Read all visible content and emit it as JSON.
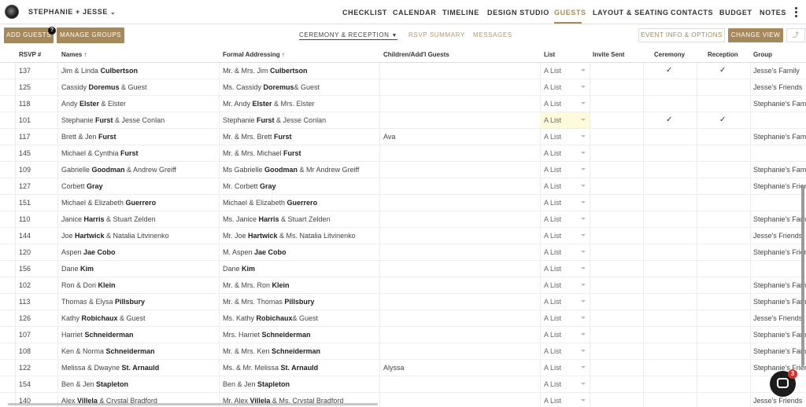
{
  "nav": {
    "couple": "STEPHANIE + JESSE",
    "items": [
      "CHECKLIST",
      "CALENDAR",
      "TIMELINE",
      "DESIGN STUDIO",
      "GUESTS",
      "LAYOUT & SEATING",
      "CONTACTS",
      "BUDGET",
      "NOTES"
    ],
    "active": "GUESTS"
  },
  "toolbar": {
    "add_guests": "ADD GUESTS",
    "help_badge": "?",
    "manage_groups": "MANAGE GROUPS",
    "views": [
      "CEREMONY & RECEPTION",
      "RSVP SUMMARY",
      "MESSAGES"
    ],
    "event_info": "EVENT INFO & OPTIONS",
    "change_view": "CHANGE VIEW"
  },
  "table": {
    "columns": [
      "RSVP #",
      "Names",
      "Formal Addressing",
      "Children/Add'l Guests",
      "List",
      "Invite Sent",
      "Ceremony",
      "Reception",
      "Group"
    ],
    "sort_indicator": "↑",
    "rows": [
      {
        "rsvp": "137",
        "name_pre": "Jim & Linda ",
        "name_bold": "Culbertson",
        "name_post": "",
        "formal_pre": "Mr. & Mrs. Jim ",
        "formal_bold": "Culbertson",
        "formal_post": "",
        "children": "",
        "list": "A List",
        "ceremony": true,
        "reception": true,
        "group": "Jesse's Family"
      },
      {
        "rsvp": "125",
        "name_pre": "Cassidy ",
        "name_bold": "Doremus",
        "name_post": " & Guest",
        "formal_pre": "Ms. Cassidy ",
        "formal_bold": "Doremus",
        "formal_post": "& Guest",
        "children": "",
        "list": "A List",
        "ceremony": false,
        "reception": false,
        "group": "Jesse's Friends"
      },
      {
        "rsvp": "118",
        "name_pre": "Andy ",
        "name_bold": "Elster",
        "name_post": " & Elster",
        "formal_pre": "Mr. Andy ",
        "formal_bold": "Elster",
        "formal_post": " & Mrs. Elster",
        "children": "",
        "list": "A List",
        "ceremony": false,
        "reception": false,
        "group": "Stephanie's Family"
      },
      {
        "rsvp": "101",
        "name_pre": "Stephanie ",
        "name_bold": "Furst",
        "name_post": " & Jesse Conlan",
        "formal_pre": "Stephanie ",
        "formal_bold": "Furst",
        "formal_post": " & Jesse Conlan",
        "children": "",
        "list": "A List",
        "ceremony": true,
        "reception": true,
        "group": "",
        "highlight": true
      },
      {
        "rsvp": "117",
        "name_pre": "Brett & Jen ",
        "name_bold": "Furst",
        "name_post": "",
        "formal_pre": "Mr. & Mrs. Brett ",
        "formal_bold": "Furst",
        "formal_post": "",
        "children": "Ava",
        "list": "A List",
        "ceremony": false,
        "reception": false,
        "group": "Stephanie's Family"
      },
      {
        "rsvp": "145",
        "name_pre": "Michael & Cynthia ",
        "name_bold": "Furst",
        "name_post": "",
        "formal_pre": "Mr. & Mrs. Michael ",
        "formal_bold": "Furst",
        "formal_post": "",
        "children": "",
        "list": "A List",
        "ceremony": false,
        "reception": false,
        "group": ""
      },
      {
        "rsvp": "109",
        "name_pre": "Gabrielle ",
        "name_bold": "Goodman",
        "name_post": " & Andrew Greiff",
        "formal_pre": "Ms Gabrielle ",
        "formal_bold": "Goodman",
        "formal_post": " & Mr Andrew Greiff",
        "children": "",
        "list": "A List",
        "ceremony": false,
        "reception": false,
        "group": "Stephanie's Family"
      },
      {
        "rsvp": "127",
        "name_pre": "Corbett ",
        "name_bold": "Gray",
        "name_post": "",
        "formal_pre": "Mr. Corbett ",
        "formal_bold": "Gray",
        "formal_post": "",
        "children": "",
        "list": "A List",
        "ceremony": false,
        "reception": false,
        "group": "Stephanie's Friends"
      },
      {
        "rsvp": "151",
        "name_pre": "Michael & Elizabeth ",
        "name_bold": "Guerrero",
        "name_post": "",
        "formal_pre": "Michael & Elizabeth ",
        "formal_bold": "Guerrero",
        "formal_post": "",
        "children": "",
        "list": "A List",
        "ceremony": false,
        "reception": false,
        "group": ""
      },
      {
        "rsvp": "110",
        "name_pre": "Janice ",
        "name_bold": "Harris",
        "name_post": " & Stuart Zelden",
        "formal_pre": "Ms. Janice ",
        "formal_bold": "Harris",
        "formal_post": " & Stuart Zelden",
        "children": "",
        "list": "A List",
        "ceremony": false,
        "reception": false,
        "group": "Stephanie's Family"
      },
      {
        "rsvp": "144",
        "name_pre": "Joe ",
        "name_bold": "Hartwick",
        "name_post": " & Natalia Litvinenko",
        "formal_pre": "Mr. Joe ",
        "formal_bold": "Hartwick",
        "formal_post": " & Ms. Natalia Litvinenko",
        "children": "",
        "list": "A List",
        "ceremony": false,
        "reception": false,
        "group": "Jesse's Friends"
      },
      {
        "rsvp": "120",
        "name_pre": "Aspen ",
        "name_bold": "Jae Cobo",
        "name_post": "",
        "formal_pre": "M. Aspen ",
        "formal_bold": "Jae Cobo",
        "formal_post": "",
        "children": "",
        "list": "A List",
        "ceremony": false,
        "reception": false,
        "group": "Stephanie's Friends"
      },
      {
        "rsvp": "156",
        "name_pre": "Dane ",
        "name_bold": "Kim",
        "name_post": "",
        "formal_pre": "Dane ",
        "formal_bold": "Kim",
        "formal_post": "",
        "children": "",
        "list": "A List",
        "ceremony": false,
        "reception": false,
        "group": ""
      },
      {
        "rsvp": "102",
        "name_pre": "Ron & Dori ",
        "name_bold": "Klein",
        "name_post": "",
        "formal_pre": "Mr. & Mrs. Ron ",
        "formal_bold": "Klein",
        "formal_post": "",
        "children": "",
        "list": "A List",
        "ceremony": false,
        "reception": false,
        "group": "Stephanie's Family"
      },
      {
        "rsvp": "113",
        "name_pre": "Thomas & Elysa ",
        "name_bold": "Pillsbury",
        "name_post": "",
        "formal_pre": "Mr. & Mrs. Thomas ",
        "formal_bold": "Pillsbury",
        "formal_post": "",
        "children": "",
        "list": "A List",
        "ceremony": false,
        "reception": false,
        "group": "Stephanie's Family"
      },
      {
        "rsvp": "126",
        "name_pre": "Kathy ",
        "name_bold": "Robichaux",
        "name_post": " & Guest",
        "formal_pre": "Ms. Kathy ",
        "formal_bold": "Robichaux",
        "formal_post": "& Guest",
        "children": "",
        "list": "A List",
        "ceremony": false,
        "reception": false,
        "group": "Jesse's Friends"
      },
      {
        "rsvp": "107",
        "name_pre": "Harriet ",
        "name_bold": "Schneiderman",
        "name_post": "",
        "formal_pre": "Mrs. Harriet ",
        "formal_bold": "Schneiderman",
        "formal_post": "",
        "children": "",
        "list": "A List",
        "ceremony": false,
        "reception": false,
        "group": "Stephanie's Family"
      },
      {
        "rsvp": "108",
        "name_pre": "Ken & Norma ",
        "name_bold": "Schneiderman",
        "name_post": "",
        "formal_pre": "Mr. & Mrs. Ken ",
        "formal_bold": "Schneiderman",
        "formal_post": "",
        "children": "",
        "list": "A List",
        "ceremony": false,
        "reception": false,
        "group": "Stephanie's Family"
      },
      {
        "rsvp": "122",
        "name_pre": "Melissa & Dwayne ",
        "name_bold": "St. Arnauld",
        "name_post": "",
        "formal_pre": "Ms. & Mr. Melissa ",
        "formal_bold": "St. Arnauld",
        "formal_post": "",
        "children": "Alyssa",
        "list": "A List",
        "ceremony": false,
        "reception": false,
        "group": "Stephanie's Friends"
      },
      {
        "rsvp": "154",
        "name_pre": "Ben & Jen ",
        "name_bold": "Stapleton",
        "name_post": "",
        "formal_pre": "Ben & Jen ",
        "formal_bold": "Stapleton",
        "formal_post": "",
        "children": "",
        "list": "A List",
        "ceremony": false,
        "reception": false,
        "group": ""
      },
      {
        "rsvp": "140",
        "name_pre": "Alex ",
        "name_bold": "Villela",
        "name_post": " & Crystal Bradford",
        "formal_pre": "Mr. Alex ",
        "formal_bold": "Villela",
        "formal_post": " & Ms. Crystal Bradford",
        "children": "",
        "list": "A List",
        "ceremony": false,
        "reception": false,
        "group": "Jesse's Friends"
      }
    ]
  },
  "chat": {
    "badge": "3"
  },
  "colors": {
    "accent": "#a6895a",
    "highlight": "#fdfbdc",
    "badge": "#d9302c"
  }
}
